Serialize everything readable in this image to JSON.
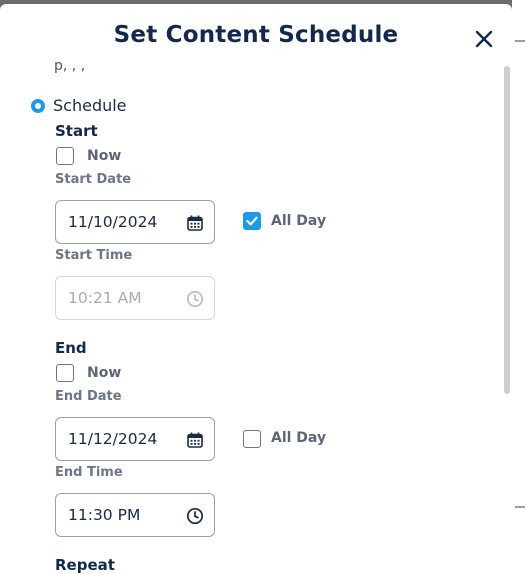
{
  "modal": {
    "title": "Set Content Schedule",
    "cut_text": "p, , ,"
  },
  "schedule_option": {
    "label": "Schedule",
    "selected": true
  },
  "start": {
    "heading": "Start",
    "now_label": "Now",
    "now_checked": false,
    "date_label": "Start Date",
    "date_value": "11/10/2024",
    "all_day_label": "All Day",
    "all_day_checked": true,
    "time_label": "Start Time",
    "time_value": "10:21 AM"
  },
  "end": {
    "heading": "End",
    "now_label": "Now",
    "now_checked": false,
    "date_label": "End Date",
    "date_value": "11/12/2024",
    "all_day_label": "All Day",
    "all_day_checked": false,
    "time_label": "End Time",
    "time_value": "11:30 PM"
  },
  "repeat": {
    "heading": "Repeat"
  },
  "icons": {
    "close": "close-icon",
    "calendar": "calendar-icon",
    "clock": "clock-icon",
    "check": "check-icon"
  },
  "colors": {
    "accent": "#1e9be6",
    "title": "#12294b",
    "muted_label": "#6c7686"
  }
}
